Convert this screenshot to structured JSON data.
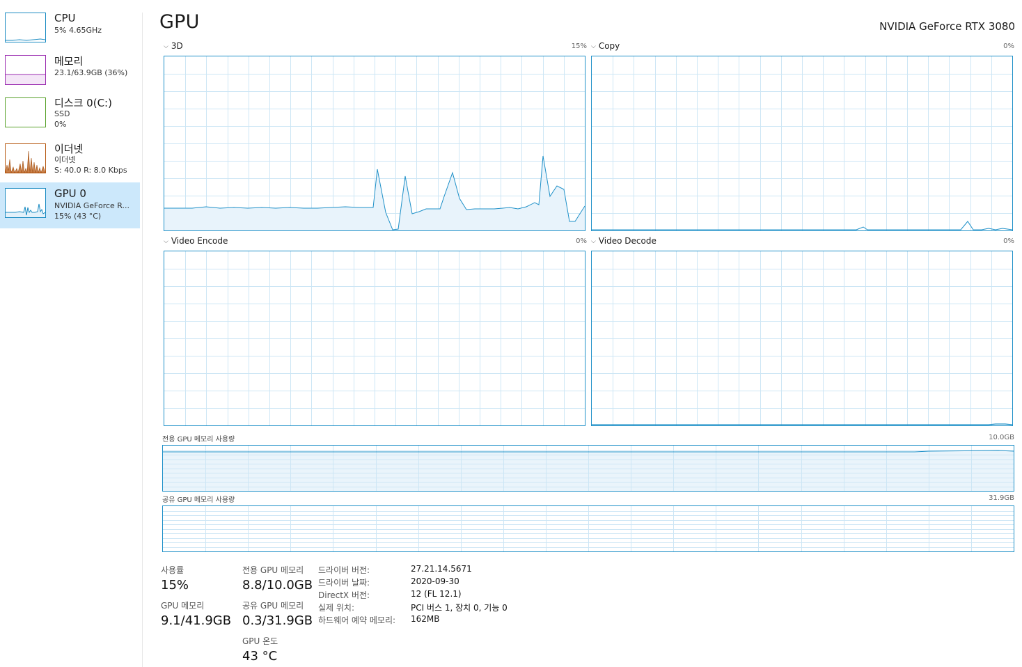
{
  "sidebar": {
    "items": [
      {
        "title": "CPU",
        "sub1": "5% 4.65GHz",
        "sub2": "",
        "sub3": "",
        "color": "#1a8bc2"
      },
      {
        "title": "메모리",
        "sub1": "23.1/63.9GB (36%)",
        "sub2": "",
        "sub3": "",
        "color": "#9b2cb0"
      },
      {
        "title": "디스크 0(C:)",
        "sub1": "SSD",
        "sub2": "0%",
        "sub3": "",
        "color": "#58a12a"
      },
      {
        "title": "이더넷",
        "sub1": "이더넷",
        "sub2": "S: 40.0  R: 8.0 Kbps",
        "sub3": "",
        "color": "#b75a14"
      },
      {
        "title": "GPU 0",
        "sub1": "NVIDIA GeForce R...",
        "sub2": "15% (43 °C)",
        "sub3": "",
        "color": "#1a8bc2",
        "selected": true
      }
    ]
  },
  "header": {
    "title": "GPU",
    "gpu_name": "NVIDIA GeForce RTX 3080"
  },
  "graphs": {
    "g3d": {
      "label": "3D",
      "max": "15%"
    },
    "copy": {
      "label": "Copy",
      "max": "0%"
    },
    "encode": {
      "label": "Video Encode",
      "max": "0%"
    },
    "decode": {
      "label": "Video Decode",
      "max": "0%"
    }
  },
  "memory_graphs": {
    "dedicated": {
      "label": "전용 GPU 메모리 사용량",
      "max": "10.0GB"
    },
    "shared": {
      "label": "공유 GPU 메모리 사용량",
      "max": "31.9GB"
    }
  },
  "stats": {
    "utilization_label": "사용률",
    "utilization_value": "15%",
    "gpu_memory_label": "GPU 메모리",
    "gpu_memory_value": "9.1/41.9GB",
    "dedicated_label": "전용 GPU 메모리",
    "dedicated_value": "8.8/10.0GB",
    "shared_label": "공유 GPU 메모리",
    "shared_value": "0.3/31.9GB",
    "temp_label": "GPU 온도",
    "temp_value": "43 °C"
  },
  "info": [
    {
      "key": "드라이버 버전:",
      "value": "27.21.14.5671"
    },
    {
      "key": "드라이버 날짜:",
      "value": "2020-09-30"
    },
    {
      "key": "DirectX 버전:",
      "value": "12 (FL 12.1)"
    },
    {
      "key": "실제 위치:",
      "value": "PCI 버스 1, 장치 0, 기능 0"
    },
    {
      "key": "하드웨어 예약 메모리:",
      "value": "162MB"
    }
  ],
  "colors": {
    "gpu_line": "#1e90c8",
    "grid": "#cde6f5"
  }
}
